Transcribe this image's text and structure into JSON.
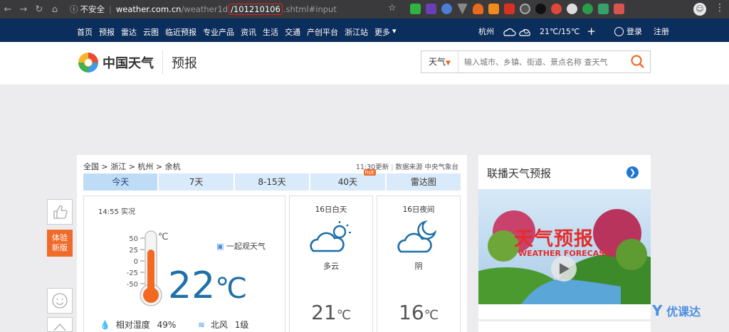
{
  "browser": {
    "security_label": "不安全",
    "url_host": "weather.com.cn",
    "url_path_before": "/weather1d",
    "url_highlight": "/101210106",
    "url_path_after": ".shtml#input"
  },
  "topnav": {
    "links": [
      "首页",
      "预报",
      "雷达",
      "云图",
      "临近预报",
      "专业产品",
      "资讯",
      "生活",
      "交通",
      "产创平台",
      "浙江站",
      "更多"
    ],
    "city": "杭州",
    "temp_range": "21℃/15℃",
    "add_label": "+",
    "login": "登录",
    "register": "注册"
  },
  "header": {
    "logo_text": "中国天气",
    "section_title": "预报",
    "search_type": "天气",
    "search_placeholder": "输入城市、乡镇、街道、景点名称 查天气"
  },
  "main": {
    "breadcrumb": "全国 > 浙江 > 杭州 > 余杭",
    "update_time": "11:30更新",
    "source": "数据来源 中央气象台",
    "tabs": [
      {
        "label": "今天"
      },
      {
        "label": "7天"
      },
      {
        "label": "8-15天"
      },
      {
        "label": "40天",
        "badge": "hot"
      },
      {
        "label": "雷达图"
      }
    ],
    "current": {
      "time": "14:55 实况",
      "unit": "℃",
      "scale": [
        "50",
        "25",
        "0",
        "-25",
        "-50"
      ],
      "temperature": "22",
      "temp_unit": "℃",
      "watch_label": "一起观天气",
      "humidity_label": "相对湿度",
      "humidity_value": "49%",
      "wind_dir": "北风",
      "wind_level": "1级"
    },
    "day": {
      "title": "16日白天",
      "desc": "多云",
      "temp": "21",
      "unit": "℃"
    },
    "night": {
      "title": "16日夜间",
      "desc": "阴",
      "temp": "16",
      "unit": "℃"
    }
  },
  "side": {
    "trial_line1": "体验",
    "trial_line2": "新版"
  },
  "right": {
    "title": "联播天气预报",
    "video_title_cn": "天气预报",
    "video_title_en": "WEATHER FORECAST"
  },
  "watermark": "优课达",
  "colors": {
    "nav_bg": "#0c2e5c",
    "accent": "#f06b2a",
    "temp_blue": "#1f6fa8",
    "tab_bg": "#d9eafa"
  }
}
